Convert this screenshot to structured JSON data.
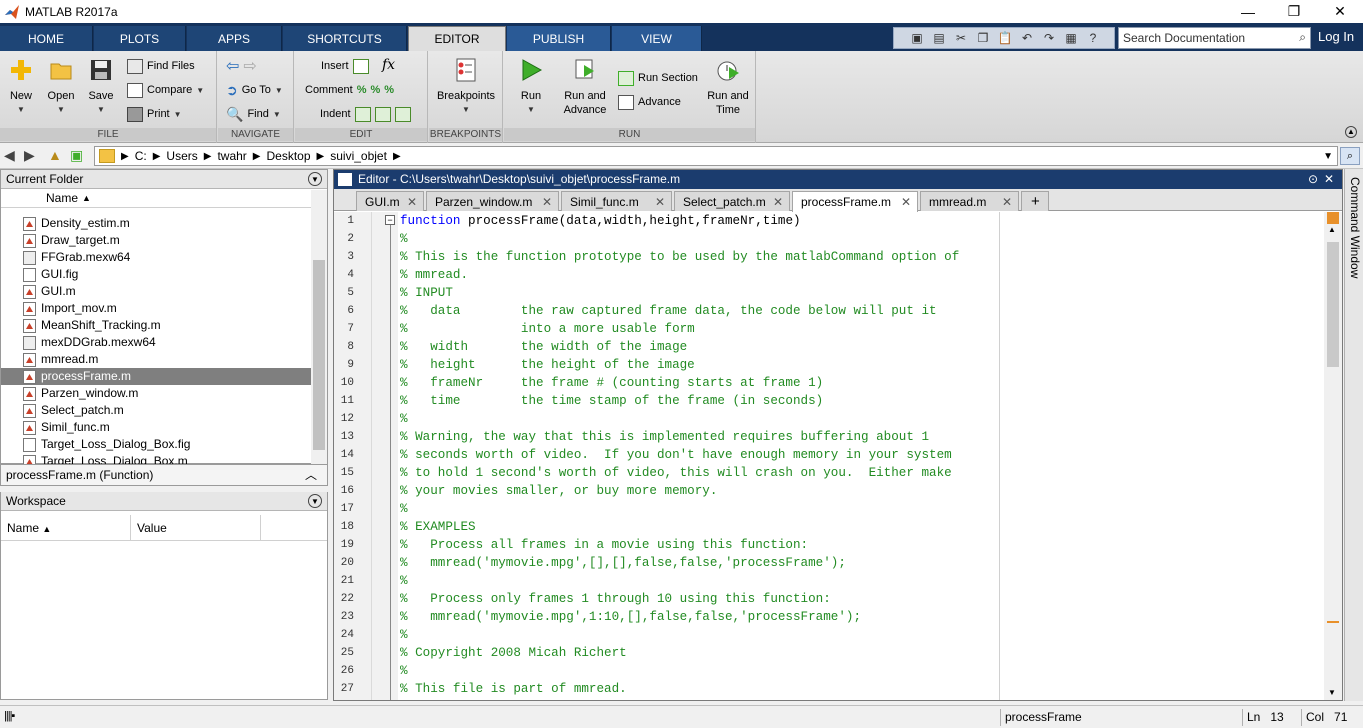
{
  "window": {
    "title": "MATLAB R2017a",
    "controls": [
      "—",
      "❐",
      "✕"
    ]
  },
  "ribbon_tabs": [
    "HOME",
    "PLOTS",
    "APPS",
    "SHORTCUTS",
    "EDITOR",
    "PUBLISH",
    "VIEW"
  ],
  "active_tab": "EDITOR",
  "search": {
    "placeholder": "Search Documentation"
  },
  "login": "Log In",
  "ribbon": {
    "file": {
      "label": "FILE",
      "new": "New",
      "open": "Open",
      "save": "Save",
      "find_files": "Find Files",
      "compare": "Compare",
      "print": "Print"
    },
    "navigate": {
      "label": "NAVIGATE",
      "go_to": "Go To",
      "find": "Find"
    },
    "edit": {
      "label": "EDIT",
      "insert": "Insert",
      "comment": "Comment",
      "indent": "Indent",
      "fx": "fx"
    },
    "breakpoints": {
      "label": "BREAKPOINTS",
      "breakpoints": "Breakpoints"
    },
    "run": {
      "label": "RUN",
      "run": "Run",
      "run_and_advance_1": "Run and",
      "run_and_advance_2": "Advance",
      "run_section": "Run Section",
      "advance": "Advance",
      "run_and_time_1": "Run and",
      "run_and_time_2": "Time"
    }
  },
  "path": [
    "C:",
    "Users",
    "twahr",
    "Desktop",
    "suivi_objet"
  ],
  "current_folder": {
    "title": "Current Folder",
    "column_name": "Name",
    "files": [
      {
        "name": "Density_estim.m",
        "type": "m"
      },
      {
        "name": "Draw_target.m",
        "type": "m"
      },
      {
        "name": "FFGrab.mexw64",
        "type": "mex"
      },
      {
        "name": "GUI.fig",
        "type": "fig"
      },
      {
        "name": "GUI.m",
        "type": "m"
      },
      {
        "name": "Import_mov.m",
        "type": "m"
      },
      {
        "name": "MeanShift_Tracking.m",
        "type": "m"
      },
      {
        "name": "mexDDGrab.mexw64",
        "type": "mex"
      },
      {
        "name": "mmread.m",
        "type": "m"
      },
      {
        "name": "processFrame.m",
        "type": "m"
      },
      {
        "name": "Parzen_window.m",
        "type": "m"
      },
      {
        "name": "Select_patch.m",
        "type": "m"
      },
      {
        "name": "Simil_func.m",
        "type": "m"
      },
      {
        "name": "Target_Loss_Dialog_Box.fig",
        "type": "fig"
      },
      {
        "name": "Target_Loss_Dialog_Box.m",
        "type": "m"
      }
    ],
    "selected": "processFrame.m"
  },
  "details": "processFrame.m  (Function)",
  "workspace": {
    "title": "Workspace",
    "col_name": "Name",
    "col_value": "Value"
  },
  "editor": {
    "title": "Editor - C:\\Users\\twahr\\Desktop\\suivi_objet\\processFrame.m",
    "tabs": [
      "GUI.m",
      "Parzen_window.m",
      "Simil_func.m",
      "Select_patch.m",
      "processFrame.m",
      "mmread.m"
    ],
    "active_tab": "processFrame.m",
    "add_tab": "+",
    "lines": [
      "function processFrame(data,width,height,frameNr,time)",
      "%",
      "% This is the function prototype to be used by the matlabCommand option of",
      "% mmread.",
      "% INPUT",
      "%   data        the raw captured frame data, the code below will put it",
      "%               into a more usable form",
      "%   width       the width of the image",
      "%   height      the height of the image",
      "%   frameNr     the frame # (counting starts at frame 1)",
      "%   time        the time stamp of the frame (in seconds)",
      "%",
      "% Warning, the way that this is implemented requires buffering about 1",
      "% seconds worth of video.  If you don't have enough memory in your system",
      "% to hold 1 second's worth of video, this will crash on you.  Either make",
      "% your movies smaller, or buy more memory.",
      "%",
      "% EXAMPLES",
      "%   Process all frames in a movie using this function:",
      "%   mmread('mymovie.mpg',[],[],false,false,'processFrame');",
      "%",
      "%   Process only frames 1 through 10 using this function:",
      "%   mmread('mymovie.mpg',1:10,[],false,false,'processFrame');",
      "%",
      "% Copyright 2008 Micah Richert",
      "%",
      "% This file is part of mmread."
    ],
    "line_numbers": [
      "1",
      "2",
      "3",
      "4",
      "5",
      "6",
      "7",
      "8",
      "9",
      "10",
      "11",
      "12",
      "13",
      "14",
      "15",
      "16",
      "17",
      "18",
      "19",
      "20",
      "21",
      "22",
      "23",
      "24",
      "25",
      "26",
      "27"
    ]
  },
  "command_window_label": "Command Window",
  "status": {
    "function": "processFrame",
    "ln_label": "Ln",
    "ln": "13",
    "col_label": "Col",
    "col": "71"
  },
  "colors": {
    "title_bar_blue": "#1b3c6e",
    "comment_green": "#228b22",
    "keyword_blue": "#0000ff",
    "selection_grey": "#7f7f7f"
  }
}
